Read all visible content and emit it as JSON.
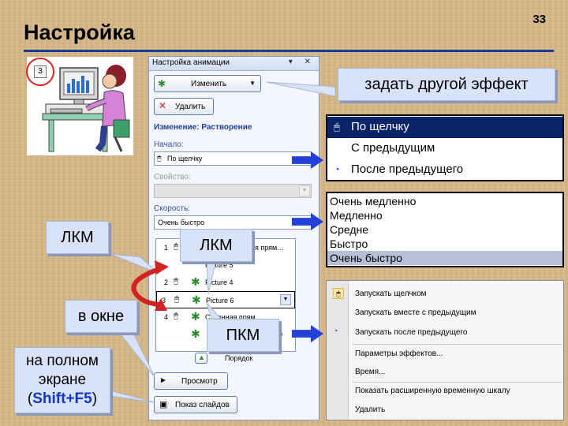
{
  "slide": {
    "title": "Настройка",
    "number": "33"
  },
  "clipart": {
    "step": "3"
  },
  "pane": {
    "title": "Настройка анимации",
    "controls": "▾ ✕",
    "change_button": "Изменить",
    "delete_button": "Удалить",
    "change_heading": "Изменение: Растворение",
    "start_label": "Начало:",
    "start_value": "По щелчку",
    "property_label": "Свойство:",
    "speed_label": "Скорость:",
    "speed_value": "Очень быстро",
    "list": [
      {
        "num": "1",
        "text": "ая прям…"
      },
      {
        "num": "",
        "text": "Picture 5"
      },
      {
        "num": "2",
        "text": "Picture 4"
      },
      {
        "num": "3",
        "text": "Picture 6"
      },
      {
        "num": "4",
        "text": "С…енная прям…"
      },
      {
        "num": "",
        "text": "10"
      }
    ],
    "order_label": "Порядок",
    "preview_button": "Просмотр",
    "slideshow_button": "Показ слайдов"
  },
  "callouts": {
    "other_effect": "задать другой эффект",
    "lmb_left": "ЛКМ",
    "lmb_mid": "ЛКМ",
    "rmb": "ПКМ",
    "in_window": "в окне",
    "fullscreen_line1": "на полном",
    "fullscreen_line2": "экране",
    "paren_open": "(",
    "shortcut": "Shift+F5",
    "paren_close": ")"
  },
  "start_menu": {
    "items": [
      {
        "icon": "mouse-icon",
        "label": "По щелчку",
        "selected": true
      },
      {
        "icon": "",
        "label": "С предыдущим",
        "selected": false
      },
      {
        "icon": "clock-icon",
        "label": "После предыдущего",
        "selected": false
      }
    ]
  },
  "speed_menu": {
    "items": [
      {
        "label": "Очень медленно",
        "selected": false
      },
      {
        "label": "Медленно",
        "selected": false
      },
      {
        "label": "Средне",
        "selected": false
      },
      {
        "label": "Быстро",
        "selected": false
      },
      {
        "label": "Очень быстро",
        "selected": true
      }
    ]
  },
  "context_menu": {
    "items": [
      {
        "label": "Запускать щелчком"
      },
      {
        "label": "Запускать вместе с предыдущим"
      },
      {
        "label": "Запускать после предыдущего"
      },
      {
        "label": "Параметры эффектов..."
      },
      {
        "label": "Время..."
      },
      {
        "label": "Показать расширенную временную шкалу"
      },
      {
        "label": "Удалить"
      }
    ]
  },
  "colors": {
    "accent": "#1a3a9c",
    "arrow": "#2341d8",
    "highlight_red": "#d22222",
    "selection": "#0a246a",
    "shortcut": "#1433c8"
  }
}
